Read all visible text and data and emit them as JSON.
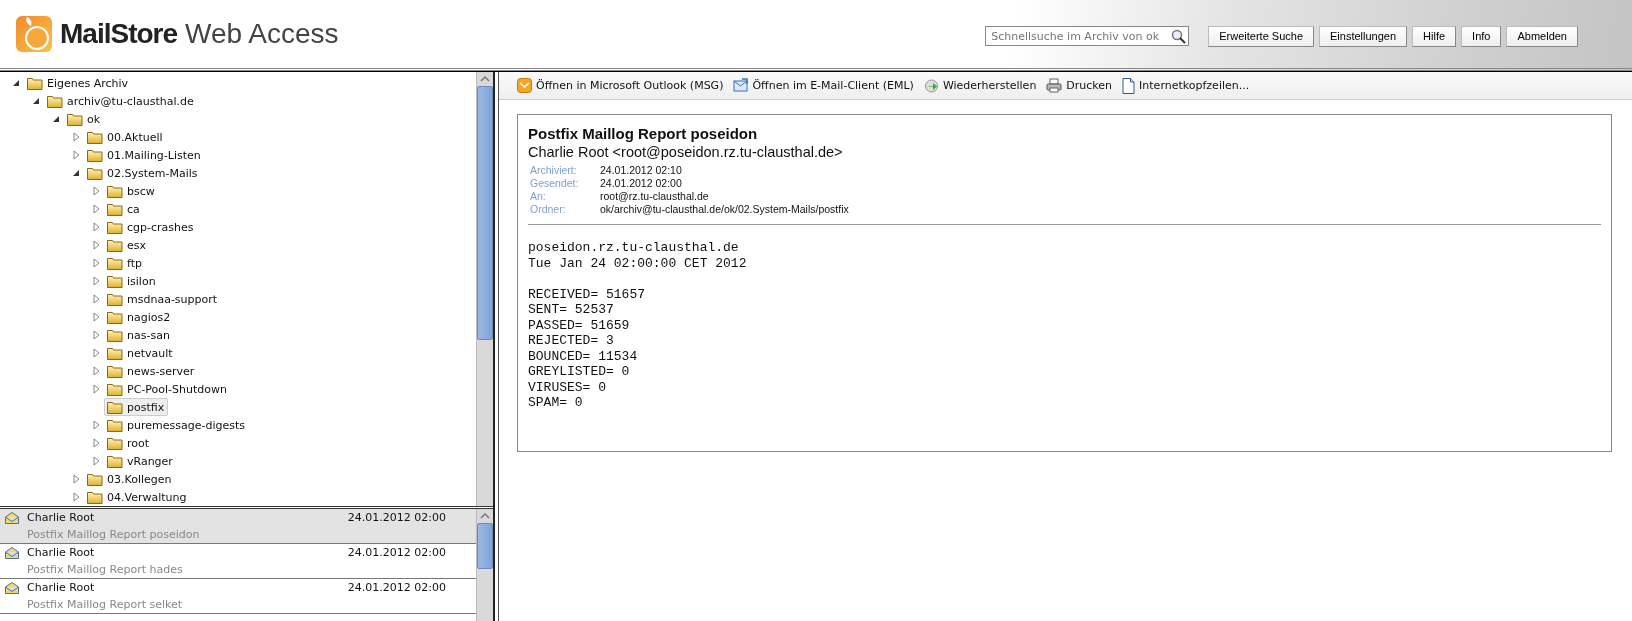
{
  "header": {
    "logo_bold": "MailStore",
    "logo_light": "Web Access",
    "search": {
      "placeholder": "Schnellsuche im Archiv von ok"
    },
    "buttons": [
      "Erweiterte Suche",
      "Einstellungen",
      "Hilfe",
      "Info",
      "Abmelden"
    ]
  },
  "tree": [
    {
      "label": "Eigenes Archiv",
      "kind": "branch",
      "expanded": true,
      "selected": false,
      "children": [
        {
          "label": "archiv@tu-clausthal.de",
          "kind": "branch",
          "expanded": true,
          "selected": false,
          "children": [
            {
              "label": "ok",
              "kind": "branch",
              "expanded": true,
              "selected": false,
              "children": [
                {
                  "label": "00.Aktuell",
                  "kind": "branch",
                  "expanded": false,
                  "selected": false
                },
                {
                  "label": "01.Mailing-Listen",
                  "kind": "branch",
                  "expanded": false,
                  "selected": false
                },
                {
                  "label": "02.System-Mails",
                  "kind": "branch",
                  "expanded": true,
                  "selected": false,
                  "children": [
                    {
                      "label": "bscw",
                      "kind": "branch",
                      "expanded": false,
                      "selected": false
                    },
                    {
                      "label": "ca",
                      "kind": "branch",
                      "expanded": false,
                      "selected": false
                    },
                    {
                      "label": "cgp-crashes",
                      "kind": "branch",
                      "expanded": false,
                      "selected": false
                    },
                    {
                      "label": "esx",
                      "kind": "branch",
                      "expanded": false,
                      "selected": false
                    },
                    {
                      "label": "ftp",
                      "kind": "branch",
                      "expanded": false,
                      "selected": false
                    },
                    {
                      "label": "isilon",
                      "kind": "branch",
                      "expanded": false,
                      "selected": false
                    },
                    {
                      "label": "msdnaa-support",
                      "kind": "branch",
                      "expanded": false,
                      "selected": false
                    },
                    {
                      "label": "nagios2",
                      "kind": "branch",
                      "expanded": false,
                      "selected": false
                    },
                    {
                      "label": "nas-san",
                      "kind": "branch",
                      "expanded": false,
                      "selected": false
                    },
                    {
                      "label": "netvault",
                      "kind": "branch",
                      "expanded": false,
                      "selected": false
                    },
                    {
                      "label": "news-server",
                      "kind": "branch",
                      "expanded": false,
                      "selected": false
                    },
                    {
                      "label": "PC-Pool-Shutdown",
                      "kind": "branch",
                      "expanded": false,
                      "selected": false
                    },
                    {
                      "label": "postfix",
                      "kind": "leaf",
                      "selected": true
                    },
                    {
                      "label": "puremessage-digests",
                      "kind": "branch",
                      "expanded": false,
                      "selected": false
                    },
                    {
                      "label": "root",
                      "kind": "branch",
                      "expanded": false,
                      "selected": false
                    },
                    {
                      "label": "vRanger",
                      "kind": "branch",
                      "expanded": false,
                      "selected": false
                    }
                  ]
                },
                {
                  "label": "03.Kollegen",
                  "kind": "branch",
                  "expanded": false,
                  "selected": false
                },
                {
                  "label": "04.Verwaltung",
                  "kind": "branch",
                  "expanded": false,
                  "selected": false
                }
              ]
            }
          ]
        }
      ]
    }
  ],
  "messages": [
    {
      "sender": "Charlie Root",
      "date": "24.01.2012 02:00",
      "subject": "Postfix Maillog Report poseidon",
      "selected": true
    },
    {
      "sender": "Charlie Root",
      "date": "24.01.2012 02:00",
      "subject": "Postfix Maillog Report hades",
      "selected": false
    },
    {
      "sender": "Charlie Root",
      "date": "24.01.2012 02:00",
      "subject": "Postfix Maillog Report selket",
      "selected": false
    }
  ],
  "toolbar": [
    {
      "kind": "outlook",
      "label": "Öffnen in Microsoft Outlook (MSG)"
    },
    {
      "kind": "client",
      "label": "Öffnen im E-Mail-Client (EML)"
    },
    {
      "kind": "restore",
      "label": "Wiederherstellen"
    },
    {
      "kind": "print",
      "label": "Drucken"
    },
    {
      "kind": "headers",
      "label": "Internetkopfzeilen..."
    }
  ],
  "mail": {
    "subject": "Postfix Maillog Report poseidon",
    "from": "Charlie Root <root@poseidon.rz.tu-clausthal.de>",
    "fields": [
      {
        "label": "Archiviert:",
        "value": "24.01.2012 02:10"
      },
      {
        "label": "Gesendet:",
        "value": "24.01.2012 02:00"
      },
      {
        "label": "An:",
        "value": "root@rz.tu-clausthal.de"
      },
      {
        "label": "Ordner:",
        "value": "ok/archiv@tu-clausthal.de/ok/02.System-Mails/postfix"
      }
    ],
    "body": [
      [
        "poseidon.rz.tu-clausthal.de",
        "Tue Jan 24 02:00:00 CET 2012"
      ],
      [
        "RECEIVED= 51657",
        "SENT= 52537",
        "PASSED= 51659",
        "REJECTED= 3",
        "BOUNCED= 11534",
        "GREYLISTED= 0",
        "VIRUSES= 0",
        "SPAM= 0"
      ]
    ]
  }
}
